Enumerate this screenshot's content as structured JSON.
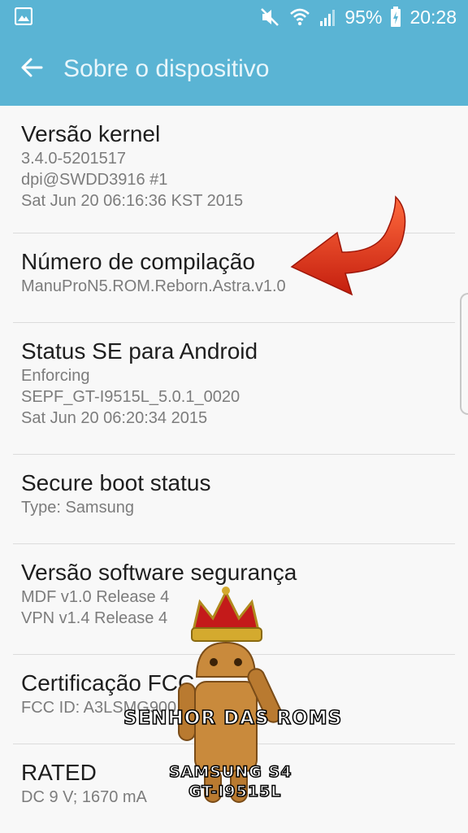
{
  "status_bar": {
    "battery": "95%",
    "time": "20:28",
    "icons": [
      "gallery-icon",
      "mute-icon",
      "wifi-icon",
      "signal-icon",
      "battery-charging-icon"
    ]
  },
  "app_bar": {
    "title": "Sobre o dispositivo",
    "back_icon": "arrow-left-icon"
  },
  "items": [
    {
      "title": "Versão kernel",
      "lines": [
        "3.4.0-5201517",
        "dpi@SWDD3916 #1",
        "Sat Jun 20 06:16:36 KST 2015"
      ]
    },
    {
      "title": "Número de compilação",
      "lines": [
        "ManuProN5.ROM.Reborn.Astra.v1.0"
      ]
    },
    {
      "title": "Status SE para Android",
      "lines": [
        "Enforcing",
        "SEPF_GT-I9515L_5.0.1_0020",
        "Sat Jun 20 06:20:34 2015"
      ]
    },
    {
      "title": "Secure boot status",
      "lines": [
        "Type: Samsung"
      ]
    },
    {
      "title": "Versão software segurança",
      "lines": [
        "MDF v1.0 Release 4",
        "VPN v1.4 Release 4"
      ]
    },
    {
      "title": "Certificação FCC",
      "lines": [
        "FCC ID: A3LSMG900"
      ]
    },
    {
      "title": "RATED",
      "lines": [
        "DC 9 V; 1670 mA"
      ]
    }
  ],
  "watermark": {
    "line1": "SENHOR DAS ROMS",
    "line2": "SAMSUNG S4",
    "line3": "GT-I9515L"
  },
  "colors": {
    "accent": "#5ab4d4",
    "arrow": "#e8391c"
  }
}
